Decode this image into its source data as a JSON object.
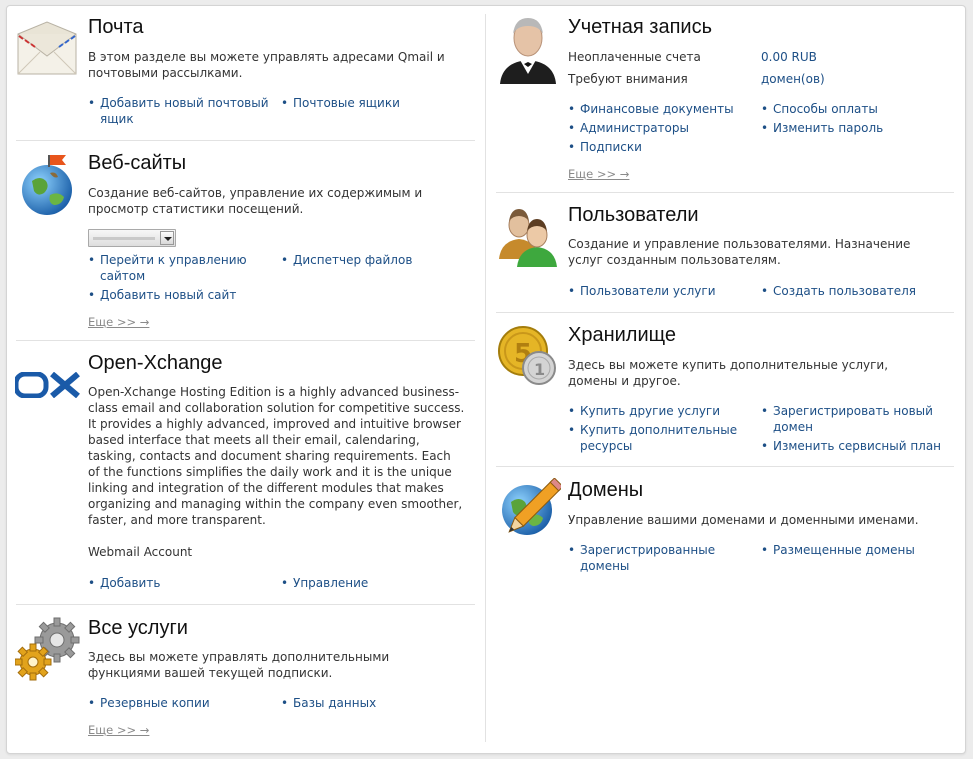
{
  "mail": {
    "title": "Почта",
    "desc": "В этом разделе вы можете управлять адресами Qmail и почтовыми рассылками.",
    "links": [
      "Добавить новый почтовый ящик",
      "Почтовые ящики"
    ]
  },
  "websites": {
    "title": "Веб-сайты",
    "desc": "Создание веб-сайтов, управление их содержимым и просмотр статистики посещений.",
    "links": [
      "Перейти к управлению сайтом",
      "Диспетчер файлов",
      "Добавить новый сайт"
    ],
    "more": "Еще >> →"
  },
  "ox": {
    "logo": "OX",
    "title": "Open-Xchange",
    "desc": "Open-Xchange Hosting Edition is a highly advanced business-class email and collaboration solution for competitive success. It provides a highly advanced, improved and intuitive browser based interface that meets all their email, calendaring, tasking, contacts and document sharing requirements. Each of the functions simplifies the daily work and it is the unique linking and integration of the different modules that makes organizing and managing within the company even smoother, faster, and more transparent.",
    "subtitle": "Webmail Account",
    "links": [
      "Добавить",
      "Управление"
    ]
  },
  "services": {
    "title": "Все услуги",
    "desc": "Здесь вы можете управлять дополнительными функциями вашей текущей подписки.",
    "links": [
      "Резервные копии",
      "Базы данных"
    ],
    "more": "Еще >> →"
  },
  "account": {
    "title": "Учетная запись",
    "unpaid_label": "Неоплаченные счета",
    "unpaid_value": "0.00 RUB",
    "attention_label": "Требуют внимания",
    "attention_value": "домен(ов)",
    "links": [
      "Финансовые документы",
      "Способы оплаты",
      "Администраторы",
      "Изменить пароль",
      "Подписки"
    ],
    "more": "Еще >> →"
  },
  "users": {
    "title": "Пользователи",
    "desc": "Создание и управление пользователями. Назначение услуг созданным пользователям.",
    "links": [
      "Пользователи услуги",
      "Создать пользователя"
    ]
  },
  "storage": {
    "title": "Хранилище",
    "desc": "Здесь вы можете купить дополнительные услуги, домены и другое.",
    "links": [
      "Купить другие услуги",
      "Зарегистрировать новый домен",
      "Купить дополнительные ресурсы",
      "Изменить сервисный план"
    ]
  },
  "domains": {
    "title": "Домены",
    "desc": "Управление вашими доменами и доменными именами.",
    "links": [
      "Зарегистрированные домены",
      "Размещенные домены"
    ]
  },
  "colors": {
    "link": "#1d4f86",
    "text": "#333333",
    "muted": "#8a8a8a",
    "ox_blue": "#1a5aa8"
  },
  "icons": [
    "envelope-icon",
    "globe-flag-icon",
    "ox-logo",
    "gears-icon",
    "user-tuxedo-icon",
    "users-group-icon",
    "coins-icon",
    "globe-pencil-icon"
  ]
}
